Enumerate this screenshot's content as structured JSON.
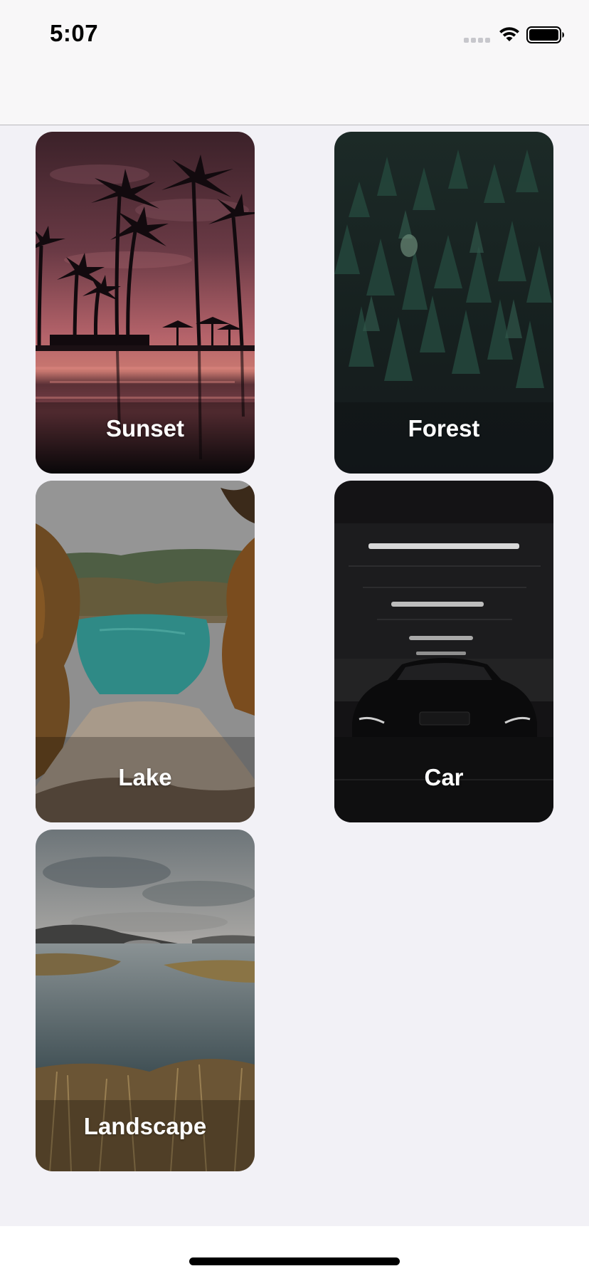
{
  "status_bar": {
    "time": "5:07",
    "icons": [
      "cellular-signal-icon",
      "wifi-icon",
      "battery-icon"
    ]
  },
  "gallery": {
    "cards": [
      {
        "label": "Sunset",
        "scene": "palm-trees-sunset"
      },
      {
        "label": "Forest",
        "scene": "pine-forest"
      },
      {
        "label": "Lake",
        "scene": "turquoise-lake"
      },
      {
        "label": "Car",
        "scene": "car-in-garage"
      },
      {
        "label": "Landscape",
        "scene": "misty-wetland"
      }
    ]
  },
  "colors": {
    "background": "#f2f1f6",
    "nav_bar": "#f8f7f8",
    "label_text": "#ffffff"
  }
}
